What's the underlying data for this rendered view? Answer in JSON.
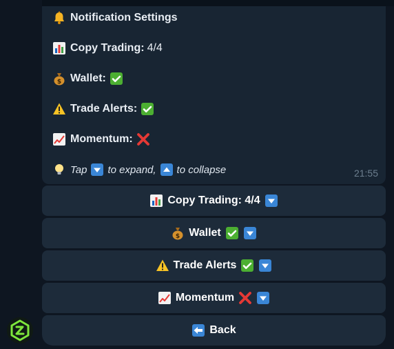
{
  "message": {
    "title": "Notification Settings",
    "title_icon": "bell-icon",
    "rows": [
      {
        "icon": "bar-chart-icon",
        "label": "Copy Trading:",
        "value": "4/4"
      },
      {
        "icon": "money-bag-icon",
        "label": "Wallet:",
        "status": "check-mark-icon"
      },
      {
        "icon": "warning-icon",
        "label": "Trade Alerts:",
        "status": "check-mark-icon"
      },
      {
        "icon": "trend-up-icon",
        "label": "Momentum:",
        "status": "cross-mark-icon"
      }
    ],
    "tip": {
      "icon": "light-bulb-icon",
      "tap": "Tap",
      "to_expand": "to expand,",
      "to_collapse": "to collapse"
    },
    "time": "21:55"
  },
  "keyboard": {
    "buttons": [
      {
        "label": "Copy Trading: 4/4",
        "icon": "bar-chart-icon",
        "suffix_icons": [
          "down-arrow-icon"
        ]
      },
      {
        "label": "Wallet",
        "icon": "money-bag-icon",
        "suffix_icons": [
          "check-mark-icon",
          "down-arrow-icon"
        ]
      },
      {
        "label": "Trade Alerts",
        "icon": "warning-icon",
        "suffix_icons": [
          "check-mark-icon",
          "down-arrow-icon"
        ]
      },
      {
        "label": "Momentum",
        "icon": "trend-up-icon",
        "suffix_icons": [
          "cross-mark-icon",
          "down-arrow-icon"
        ]
      },
      {
        "label": "Back",
        "icon": "back-arrow-icon",
        "suffix_icons": []
      }
    ]
  },
  "bot_avatar": {
    "icon": "bot-logo-icon"
  },
  "colors": {
    "background": "#0e1621",
    "bubble": "#182533",
    "button": "#1d2b3a",
    "keycap_blue": "#3a86d6",
    "check_green": "#4caf32",
    "cross_red": "#e53935",
    "logo_green": "#7ee63c"
  }
}
